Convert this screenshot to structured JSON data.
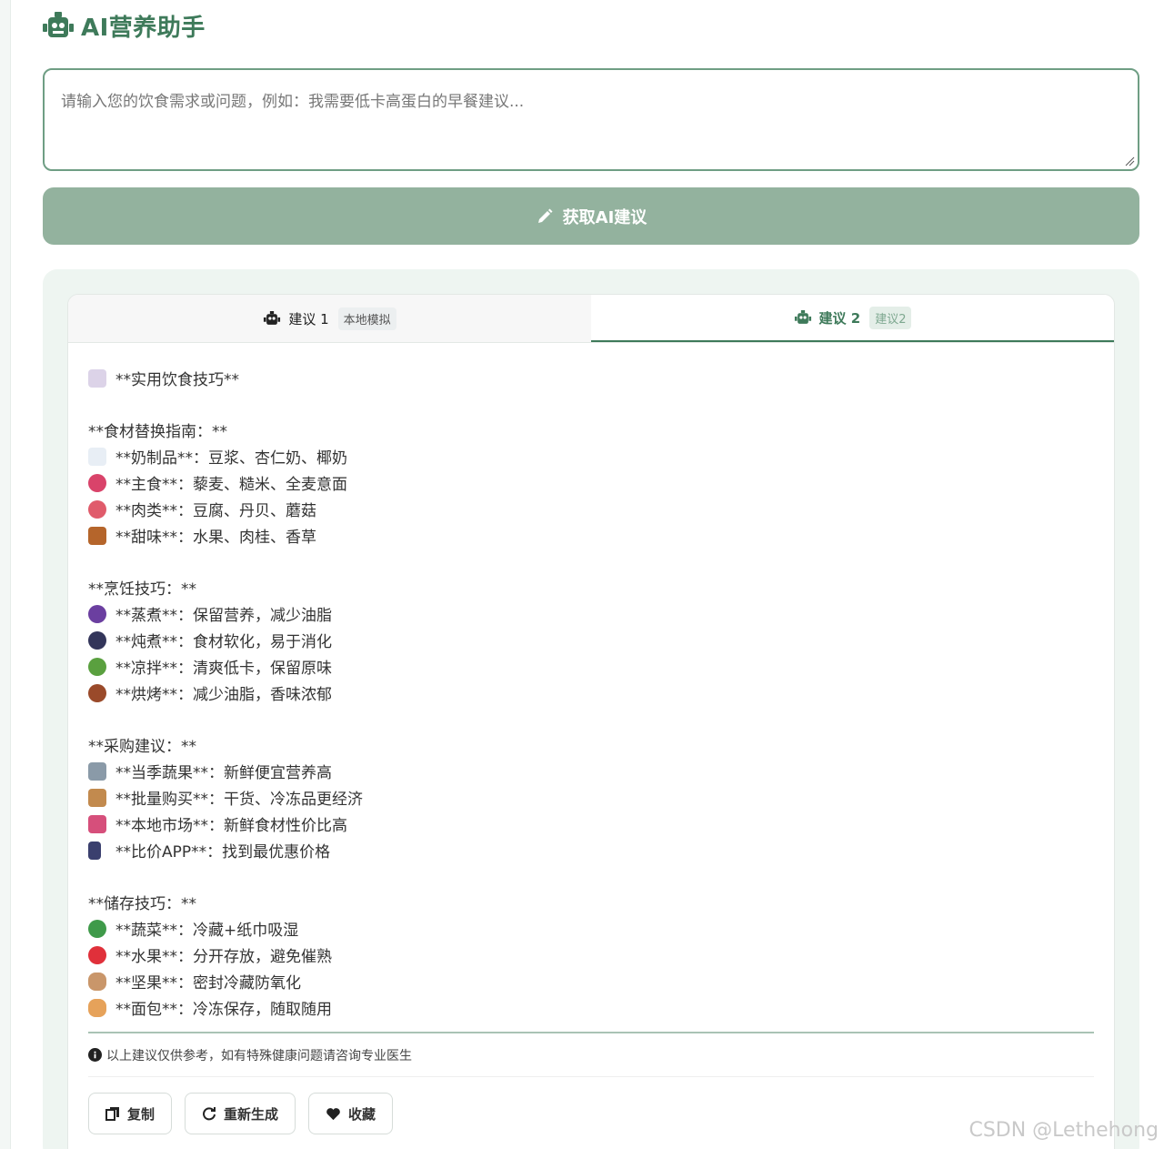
{
  "app": {
    "title": "AI营养助手",
    "icon": "robot-icon"
  },
  "input": {
    "placeholder": "请输入您的饮食需求或问题，例如：我需要低卡高蛋白的早餐建议..."
  },
  "primary_button": {
    "label": "获取AI建议",
    "icon": "pencil-icon"
  },
  "tabs": [
    {
      "label": "建议 1",
      "badge": "本地模拟",
      "icon": "robot-icon",
      "active": false
    },
    {
      "label": "建议 2",
      "badge": "建议2",
      "icon": "robot-icon",
      "active": true
    }
  ],
  "content": {
    "heading": "**实用饮食技巧**",
    "sections": [
      {
        "title": "**食材替换指南：**",
        "items": [
          {
            "text": "**奶制品**：豆浆、杏仁奶、椰奶",
            "emoji": "milk-glass",
            "color": "#e8eef5"
          },
          {
            "text": "**主食**：藜麦、糙米、全麦意面",
            "emoji": "rice-bowl",
            "color": "#d9436a"
          },
          {
            "text": "**肉类**：豆腐、丹贝、蘑菇",
            "emoji": "meat",
            "color": "#e05b6b"
          },
          {
            "text": "**甜味**：水果、肉桂、香草",
            "emoji": "honey-pot",
            "color": "#b5652b"
          }
        ]
      },
      {
        "title": "**烹饪技巧：**",
        "items": [
          {
            "text": "**蒸煮**：保留营养，减少油脂",
            "emoji": "magnifier",
            "color": "#6b3fa0"
          },
          {
            "text": "**炖煮**：食材软化，易于消化",
            "emoji": "pan-egg",
            "color": "#33355a"
          },
          {
            "text": "**凉拌**：清爽低卡，保留原味",
            "emoji": "lettuce",
            "color": "#5aa03f"
          },
          {
            "text": "**烘烤**：减少油脂，香味浓郁",
            "emoji": "drumstick",
            "color": "#9a4a2a"
          }
        ]
      },
      {
        "title": "**采购建议：**",
        "items": [
          {
            "text": "**当季蔬果**：新鲜便宜营养高",
            "emoji": "shopping-cart",
            "color": "#8a9aa8"
          },
          {
            "text": "**批量购买**：干货、冷冻品更经济",
            "emoji": "package",
            "color": "#c28a4e"
          },
          {
            "text": "**本地市场**：新鲜食材性价比高",
            "emoji": "store",
            "color": "#d64f7b"
          },
          {
            "text": "**比价APP**：找到最优惠价格",
            "emoji": "phone",
            "color": "#3a3f6e"
          }
        ]
      },
      {
        "title": "**储存技巧：**",
        "items": [
          {
            "text": "**蔬菜**：冷藏+纸巾吸湿",
            "emoji": "broccoli",
            "color": "#3f9a4a"
          },
          {
            "text": "**水果**：分开存放，避免催熟",
            "emoji": "apple",
            "color": "#e0303a"
          },
          {
            "text": "**坚果**：密封冷藏防氧化",
            "emoji": "peanut",
            "color": "#c9966a"
          },
          {
            "text": "**面包**：冷冻保存，随取随用",
            "emoji": "baguette",
            "color": "#e6a25a"
          }
        ]
      }
    ],
    "note": "以上建议仅供参考，如有特殊健康问题请咨询专业医生"
  },
  "actions": [
    {
      "label": "复制",
      "icon": "copy-icon"
    },
    {
      "label": "重新生成",
      "icon": "refresh-icon"
    },
    {
      "label": "收藏",
      "icon": "heart-icon"
    }
  ],
  "watermark": "CSDN @Lethehong",
  "colors": {
    "brand": "#3e7a5a",
    "button": "#93b29e",
    "panel": "#eef5f1"
  }
}
